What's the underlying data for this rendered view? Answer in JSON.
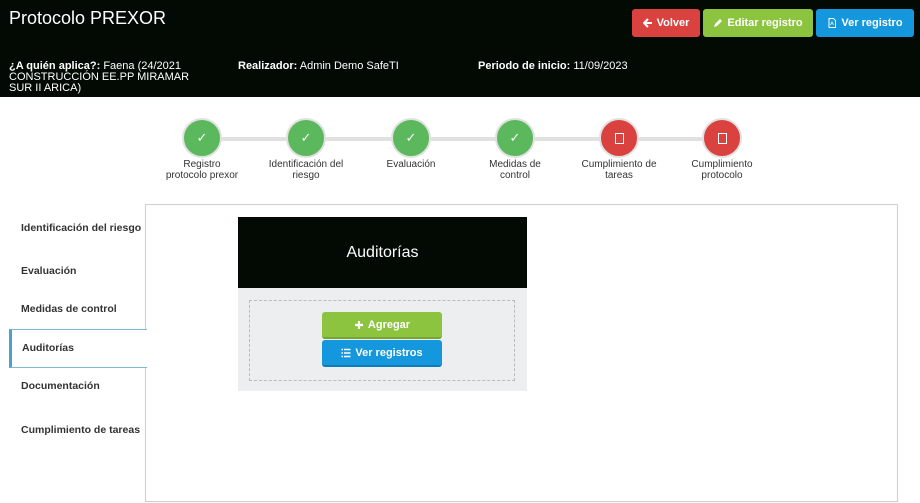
{
  "header": {
    "title": "Protocolo PREXOR",
    "back_label": "Volver",
    "edit_label": "Editar registro",
    "view_label": "Ver registro"
  },
  "info": {
    "applies_label": "¿A quién aplica?:",
    "applies_value": "Faena (24/2021 CONSTRUCCIÓN EE.PP MIRAMAR SUR II ARICA)",
    "realizer_label": "Realizador:",
    "realizer_value": "Admin Demo SafeTI",
    "start_label": "Periodo de inicio:",
    "start_value": "11/09/2023"
  },
  "steps": [
    {
      "label": "Registro protocolo prexor",
      "status": "done"
    },
    {
      "label": "Identificación del riesgo",
      "status": "done"
    },
    {
      "label": "Evaluación",
      "status": "done"
    },
    {
      "label": "Medidas de control",
      "status": "done"
    },
    {
      "label": "Cumplimiento de tareas",
      "status": "pending"
    },
    {
      "label": "Cumplimiento protocolo",
      "status": "pending"
    }
  ],
  "sidebar": {
    "items": [
      {
        "label": "Identificación del riesgo"
      },
      {
        "label": "Evaluación"
      },
      {
        "label": "Medidas de control"
      },
      {
        "label": "Auditorías"
      },
      {
        "label": "Documentación"
      },
      {
        "label": "Cumplimiento de tareas"
      }
    ],
    "active": "Auditorías"
  },
  "panel": {
    "title": "Auditorías",
    "add_label": "Agregar",
    "view_records_label": "Ver registros"
  },
  "colors": {
    "header_bg": "#020a03",
    "danger": "#d9423f",
    "success": "#8cc43f",
    "info": "#1597dd",
    "step_done": "#5cb85c"
  }
}
